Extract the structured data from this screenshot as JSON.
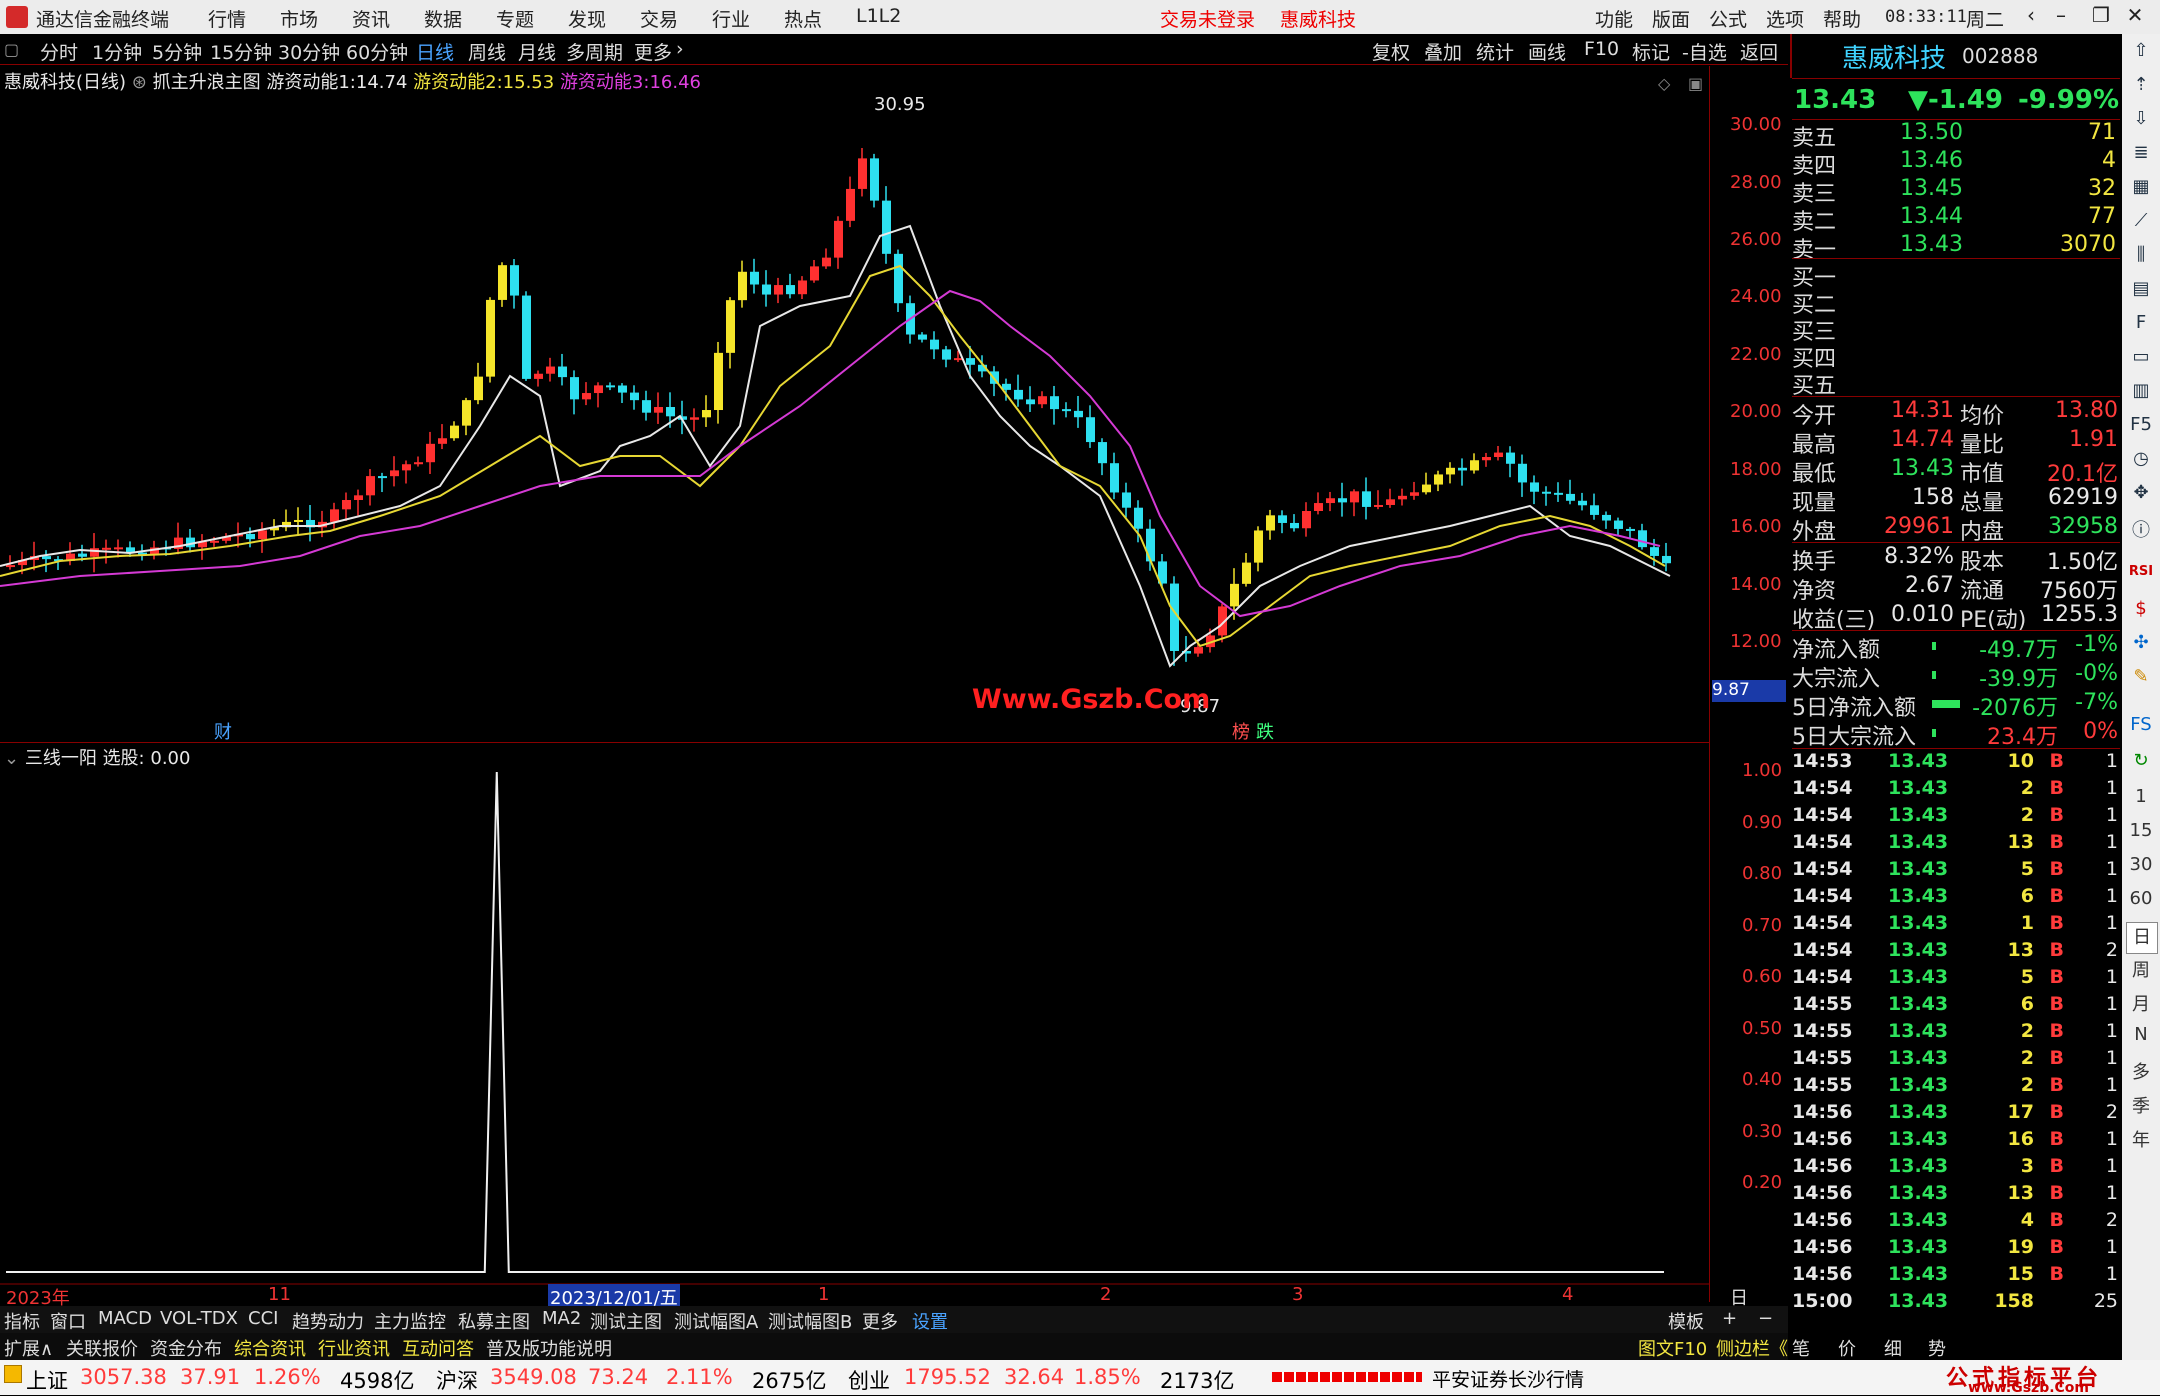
{
  "title_bar": {
    "app_name": "通达信金融终端",
    "menu": [
      "行情",
      "市场",
      "资讯",
      "数据",
      "专题",
      "发现",
      "交易",
      "行业",
      "热点",
      "L1L2"
    ],
    "warn_login": "交易未登录",
    "warn_stock": "惠威科技",
    "right_menu": [
      "功能",
      "版面",
      "公式",
      "选项",
      "帮助"
    ],
    "time": "08:33:11",
    "weekday": "周二"
  },
  "toolbar": {
    "periods": [
      "分时",
      "1分钟",
      "5分钟",
      "15分钟",
      "30分钟",
      "60分钟",
      "日线",
      "周线",
      "月线",
      "多周期",
      "更多"
    ],
    "active_period": "日线",
    "buttons": [
      "复权",
      "叠加",
      "统计",
      "画线",
      "F10",
      "标记",
      "-自选",
      "返回"
    ]
  },
  "main_chart": {
    "header_stock": "惠威科技(日线)",
    "header_formula": "抓主升浪主图",
    "ind1_label": "游资动能1:",
    "ind1_value": "14.74",
    "ind2_label": "游资动能2:",
    "ind2_value": "15.53",
    "ind3_label": "游资动能3:",
    "ind3_value": "16.46",
    "y_ticks": [
      "30.00",
      "28.00",
      "26.00",
      "24.00",
      "22.00",
      "20.00",
      "18.00",
      "16.00",
      "14.00",
      "12.00"
    ],
    "high_label": "30.95",
    "low_label": "9.87",
    "price_box": "9.87",
    "watermark": "Www.Gszb.Com",
    "marker_cai": "财",
    "marker_bang": "榜",
    "marker_die": "跌"
  },
  "sub_chart": {
    "header": "三线一阳",
    "select_label": "选股:",
    "select_value": "0.00",
    "y_ticks": [
      "1.00",
      "0.90",
      "0.80",
      "0.70",
      "0.60",
      "0.50",
      "0.40",
      "0.30",
      "0.20"
    ],
    "x_labels": [
      "2023年",
      "11",
      "2023/12/01/五",
      "1",
      "2",
      "3",
      "4"
    ],
    "period_label": "日线"
  },
  "chart_data": {
    "type": "line",
    "series": [
      {
        "name": "选股",
        "spike_at_fraction_of_range": 0.4,
        "values": [
          0,
          0,
          0,
          0,
          1,
          0,
          0,
          0,
          0,
          0
        ]
      }
    ],
    "ylim": [
      0,
      1.0
    ]
  },
  "quote_panel": {
    "stock_name": "惠威科技",
    "stock_code": "002888",
    "price": "13.43",
    "change": "▼-1.49",
    "change_pct": "-9.99%",
    "asks": [
      {
        "label": "卖五",
        "price": "13.50",
        "vol": "71"
      },
      {
        "label": "卖四",
        "price": "13.46",
        "vol": "4"
      },
      {
        "label": "卖三",
        "price": "13.45",
        "vol": "32"
      },
      {
        "label": "卖二",
        "price": "13.44",
        "vol": "77"
      },
      {
        "label": "卖一",
        "price": "13.43",
        "vol": "3070"
      }
    ],
    "bids": [
      "买一",
      "买二",
      "买三",
      "买四",
      "买五"
    ],
    "stats": [
      {
        "l1": "今开",
        "v1": "14.31",
        "l2": "均价",
        "v2": "13.80"
      },
      {
        "l1": "最高",
        "v1": "14.74",
        "l2": "量比",
        "v2": "1.91"
      },
      {
        "l1": "最低",
        "v1": "13.43",
        "l2": "市值",
        "v2": "20.1亿"
      },
      {
        "l1": "现量",
        "v1": "158",
        "l2": "总量",
        "v2": "62919"
      },
      {
        "l1": "外盘",
        "v1": "29961",
        "l2": "内盘",
        "v2": "32958"
      }
    ],
    "stats2": [
      {
        "l1": "换手",
        "v1": "8.32%",
        "l2": "股本",
        "v2": "1.50亿"
      },
      {
        "l1": "净资",
        "v1": "2.67",
        "l2": "流通",
        "v2": "7560万"
      },
      {
        "l1": "收益(三)",
        "v1": "0.010",
        "l2": "PE(动)",
        "v2": "1255.3"
      }
    ],
    "flows": [
      {
        "label": "净流入额",
        "value": "-49.7万",
        "pct": "-1%"
      },
      {
        "label": "大宗流入",
        "value": "-39.9万",
        "pct": "-0%"
      },
      {
        "label": "5日净流入额",
        "value": "-2076万",
        "pct": "-7%"
      },
      {
        "label": "5日大宗流入",
        "value": "23.4万",
        "pct": "0%"
      }
    ],
    "ticks": [
      {
        "t": "14:53",
        "p": "13.43",
        "v": "10",
        "s": "B",
        "n": "1"
      },
      {
        "t": "14:54",
        "p": "13.43",
        "v": "2",
        "s": "B",
        "n": "1"
      },
      {
        "t": "14:54",
        "p": "13.43",
        "v": "2",
        "s": "B",
        "n": "1"
      },
      {
        "t": "14:54",
        "p": "13.43",
        "v": "13",
        "s": "B",
        "n": "1"
      },
      {
        "t": "14:54",
        "p": "13.43",
        "v": "5",
        "s": "B",
        "n": "1"
      },
      {
        "t": "14:54",
        "p": "13.43",
        "v": "6",
        "s": "B",
        "n": "1"
      },
      {
        "t": "14:54",
        "p": "13.43",
        "v": "1",
        "s": "B",
        "n": "1"
      },
      {
        "t": "14:54",
        "p": "13.43",
        "v": "13",
        "s": "B",
        "n": "2"
      },
      {
        "t": "14:54",
        "p": "13.43",
        "v": "5",
        "s": "B",
        "n": "1"
      },
      {
        "t": "14:55",
        "p": "13.43",
        "v": "6",
        "s": "B",
        "n": "1"
      },
      {
        "t": "14:55",
        "p": "13.43",
        "v": "2",
        "s": "B",
        "n": "1"
      },
      {
        "t": "14:55",
        "p": "13.43",
        "v": "2",
        "s": "B",
        "n": "1"
      },
      {
        "t": "14:55",
        "p": "13.43",
        "v": "2",
        "s": "B",
        "n": "1"
      },
      {
        "t": "14:56",
        "p": "13.43",
        "v": "17",
        "s": "B",
        "n": "2"
      },
      {
        "t": "14:56",
        "p": "13.43",
        "v": "16",
        "s": "B",
        "n": "1"
      },
      {
        "t": "14:56",
        "p": "13.43",
        "v": "3",
        "s": "B",
        "n": "1"
      },
      {
        "t": "14:56",
        "p": "13.43",
        "v": "13",
        "s": "B",
        "n": "1"
      },
      {
        "t": "14:56",
        "p": "13.43",
        "v": "4",
        "s": "B",
        "n": "2"
      },
      {
        "t": "14:56",
        "p": "13.43",
        "v": "19",
        "s": "B",
        "n": "1"
      },
      {
        "t": "14:56",
        "p": "13.43",
        "v": "15",
        "s": "B",
        "n": "1"
      },
      {
        "t": "15:00",
        "p": "13.43",
        "v": "158",
        "s": "",
        "n": "25"
      }
    ]
  },
  "sidebar_labels": [
    "1",
    "15",
    "30",
    "60",
    "日",
    "周",
    "月",
    "N",
    "多",
    "季",
    "年"
  ],
  "tabs": [
    "指标",
    "窗口",
    "MACD",
    "VOL-TDX",
    "CCI",
    "趋势动力",
    "主力监控",
    "私募主图",
    "MA2",
    "测试主图",
    "测试幅图A",
    "测试幅图B",
    "更多",
    "设置"
  ],
  "tabs_right": "模板",
  "tabs2": [
    "扩展∧",
    "关联报价",
    "资金分布",
    "综合资讯",
    "行业资讯",
    "互动问答",
    "普及版功能说明"
  ],
  "tabs2_right": [
    "图文F10",
    "侧边栏《",
    "笔",
    "价",
    "细",
    "势"
  ],
  "status": {
    "sh_label": "上证",
    "sh_val": "3057.38",
    "sh_chg": "37.91",
    "sh_pct": "1.26%",
    "sh_amt": "4598亿",
    "sz_label": "沪深",
    "sz_val": "3549.08",
    "sz_chg": "73.24",
    "sz_pct": "2.11%",
    "sz_amt": "2675亿",
    "cy_label": "创业",
    "cy_val": "1795.52",
    "cy_chg": "32.64",
    "cy_pct": "1.85%",
    "cy_amt": "2173亿",
    "broker": "平安证券长沙行情",
    "brand": "公式指标平台",
    "brand_url": "www.Gszb.Com"
  }
}
